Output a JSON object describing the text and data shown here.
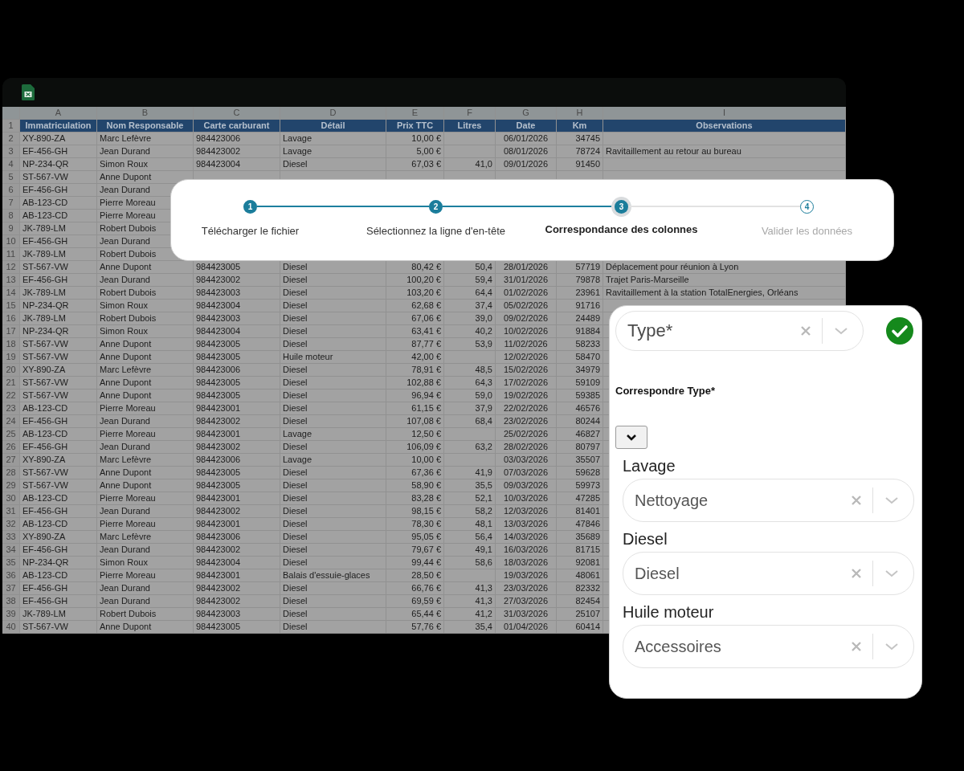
{
  "spreadsheet": {
    "column_letters": [
      "A",
      "B",
      "C",
      "D",
      "E",
      "F",
      "G",
      "H",
      "I"
    ],
    "header": {
      "n": "1",
      "cells": [
        "Immatriculation",
        "Nom Responsable",
        "Carte carburant",
        "Détail",
        "Prix TTC",
        "Litres",
        "Date",
        "Km",
        "Observations"
      ]
    },
    "rows": [
      {
        "n": "2",
        "cells": [
          "XY-890-ZA",
          "Marc Lefèvre",
          "984423006",
          "Lavage",
          "10,00 €",
          null,
          "06/01/2026",
          "34745",
          null
        ]
      },
      {
        "n": "3",
        "cells": [
          "EF-456-GH",
          "Jean Durand",
          "984423002",
          "Lavage",
          "5,00 €",
          null,
          "08/01/2026",
          "78724",
          "Ravitaillement au retour au bureau"
        ]
      },
      {
        "n": "4",
        "cells": [
          "NP-234-QR",
          "Simon Roux",
          "984423004",
          "Diesel",
          "67,03 €",
          "41,0",
          "09/01/2026",
          "91450",
          null
        ]
      },
      {
        "n": "5",
        "cells": [
          "ST-567-VW",
          "Anne Dupont"
        ]
      },
      {
        "n": "6",
        "cells": [
          "EF-456-GH",
          "Jean Durand"
        ]
      },
      {
        "n": "7",
        "cells": [
          "AB-123-CD",
          "Pierre Moreau"
        ]
      },
      {
        "n": "8",
        "cells": [
          "AB-123-CD",
          "Pierre Moreau"
        ]
      },
      {
        "n": "9",
        "cells": [
          "JK-789-LM",
          "Robert Dubois"
        ]
      },
      {
        "n": "10",
        "cells": [
          "EF-456-GH",
          "Jean Durand"
        ]
      },
      {
        "n": "11",
        "cells": [
          "JK-789-LM",
          "Robert Dubois"
        ]
      },
      {
        "n": "12",
        "cells": [
          "ST-567-VW",
          "Anne Dupont",
          "984423005",
          "Diesel",
          "80,42 €",
          "50,4",
          "28/01/2026",
          "57719",
          "Déplacement pour réunion à Lyon"
        ]
      },
      {
        "n": "13",
        "cells": [
          "EF-456-GH",
          "Jean Durand",
          "984423002",
          "Diesel",
          "100,20 €",
          "59,4",
          "31/01/2026",
          "79878",
          "Trajet Paris-Marseille"
        ]
      },
      {
        "n": "14",
        "cells": [
          "JK-789-LM",
          "Robert Dubois",
          "984423003",
          "Diesel",
          "103,20 €",
          "64,4",
          "01/02/2026",
          "23961",
          "Ravitaillement à la station TotalEnergies, Orléans"
        ]
      },
      {
        "n": "15",
        "cells": [
          "NP-234-QR",
          "Simon Roux",
          "984423004",
          "Diesel",
          "62,68 €",
          "37,4",
          "05/02/2026",
          "91716"
        ]
      },
      {
        "n": "16",
        "cells": [
          "JK-789-LM",
          "Robert Dubois",
          "984423003",
          "Diesel",
          "67,06 €",
          "39,0",
          "09/02/2026",
          "24489"
        ]
      },
      {
        "n": "17",
        "cells": [
          "NP-234-QR",
          "Simon Roux",
          "984423004",
          "Diesel",
          "63,41 €",
          "40,2",
          "10/02/2026",
          "91884"
        ]
      },
      {
        "n": "18",
        "cells": [
          "ST-567-VW",
          "Anne Dupont",
          "984423005",
          "Diesel",
          "87,77 €",
          "53,9",
          "11/02/2026",
          "58233"
        ]
      },
      {
        "n": "19",
        "cells": [
          "ST-567-VW",
          "Anne Dupont",
          "984423005",
          "Huile moteur",
          "42,00 €",
          null,
          "12/02/2026",
          "58470"
        ]
      },
      {
        "n": "20",
        "cells": [
          "XY-890-ZA",
          "Marc Lefèvre",
          "984423006",
          "Diesel",
          "78,91 €",
          "48,5",
          "15/02/2026",
          "34979"
        ]
      },
      {
        "n": "21",
        "cells": [
          "ST-567-VW",
          "Anne Dupont",
          "984423005",
          "Diesel",
          "102,88 €",
          "64,3",
          "17/02/2026",
          "59109"
        ]
      },
      {
        "n": "22",
        "cells": [
          "ST-567-VW",
          "Anne Dupont",
          "984423005",
          "Diesel",
          "96,94 €",
          "59,0",
          "19/02/2026",
          "59385"
        ]
      },
      {
        "n": "23",
        "cells": [
          "AB-123-CD",
          "Pierre Moreau",
          "984423001",
          "Diesel",
          "61,15 €",
          "37,9",
          "22/02/2026",
          "46576"
        ]
      },
      {
        "n": "24",
        "cells": [
          "EF-456-GH",
          "Jean Durand",
          "984423002",
          "Diesel",
          "107,08 €",
          "68,4",
          "23/02/2026",
          "80244"
        ]
      },
      {
        "n": "25",
        "cells": [
          "AB-123-CD",
          "Pierre Moreau",
          "984423001",
          "Lavage",
          "12,50 €",
          null,
          "25/02/2026",
          "46827"
        ]
      },
      {
        "n": "26",
        "cells": [
          "EF-456-GH",
          "Jean Durand",
          "984423002",
          "Diesel",
          "106,09 €",
          "63,2",
          "28/02/2026",
          "80797"
        ]
      },
      {
        "n": "27",
        "cells": [
          "XY-890-ZA",
          "Marc Lefèvre",
          "984423006",
          "Lavage",
          "10,00 €",
          null,
          "03/03/2026",
          "35507"
        ]
      },
      {
        "n": "28",
        "cells": [
          "ST-567-VW",
          "Anne Dupont",
          "984423005",
          "Diesel",
          "67,36 €",
          "41,9",
          "07/03/2026",
          "59628"
        ]
      },
      {
        "n": "29",
        "cells": [
          "ST-567-VW",
          "Anne Dupont",
          "984423005",
          "Diesel",
          "58,90 €",
          "35,5",
          "09/03/2026",
          "59973"
        ]
      },
      {
        "n": "30",
        "cells": [
          "AB-123-CD",
          "Pierre Moreau",
          "984423001",
          "Diesel",
          "83,28 €",
          "52,1",
          "10/03/2026",
          "47285"
        ]
      },
      {
        "n": "31",
        "cells": [
          "EF-456-GH",
          "Jean Durand",
          "984423002",
          "Diesel",
          "98,15 €",
          "58,2",
          "12/03/2026",
          "81401"
        ]
      },
      {
        "n": "32",
        "cells": [
          "AB-123-CD",
          "Pierre Moreau",
          "984423001",
          "Diesel",
          "78,30 €",
          "48,1",
          "13/03/2026",
          "47846"
        ]
      },
      {
        "n": "33",
        "cells": [
          "XY-890-ZA",
          "Marc Lefèvre",
          "984423006",
          "Diesel",
          "95,05 €",
          "56,4",
          "14/03/2026",
          "35689"
        ]
      },
      {
        "n": "34",
        "cells": [
          "EF-456-GH",
          "Jean Durand",
          "984423002",
          "Diesel",
          "79,67 €",
          "49,1",
          "16/03/2026",
          "81715"
        ]
      },
      {
        "n": "35",
        "cells": [
          "NP-234-QR",
          "Simon Roux",
          "984423004",
          "Diesel",
          "99,44 €",
          "58,6",
          "18/03/2026",
          "92081"
        ]
      },
      {
        "n": "36",
        "cells": [
          "AB-123-CD",
          "Pierre Moreau",
          "984423001",
          "Balais d'essuie-glaces",
          "28,50 €",
          null,
          "19/03/2026",
          "48061"
        ]
      },
      {
        "n": "37",
        "cells": [
          "EF-456-GH",
          "Jean Durand",
          "984423002",
          "Diesel",
          "66,76 €",
          "41,3",
          "23/03/2026",
          "82332"
        ]
      },
      {
        "n": "38",
        "cells": [
          "EF-456-GH",
          "Jean Durand",
          "984423002",
          "Diesel",
          "69,59 €",
          "41,3",
          "27/03/2026",
          "82454"
        ]
      },
      {
        "n": "39",
        "cells": [
          "JK-789-LM",
          "Robert Dubois",
          "984423003",
          "Diesel",
          "65,44 €",
          "41,2",
          "31/03/2026",
          "25107"
        ]
      },
      {
        "n": "40",
        "cells": [
          "ST-567-VW",
          "Anne Dupont",
          "984423005",
          "Diesel",
          "57,76 €",
          "35,4",
          "01/04/2026",
          "60414"
        ]
      }
    ]
  },
  "stepper": {
    "steps": [
      {
        "number": "1",
        "label": "Télécharger le fichier",
        "kind": "done"
      },
      {
        "number": "2",
        "label": "Sélectionnez la ligne d'en-tête",
        "kind": "done"
      },
      {
        "number": "3",
        "label": "Correspondance des colonnes",
        "kind": "current"
      },
      {
        "number": "4",
        "label": "Valider les données",
        "kind": "upcoming"
      }
    ]
  },
  "mapping_panel": {
    "type_field": {
      "value": "Type*",
      "valid": true
    },
    "match_label": "Correspondre Type*",
    "mappings": [
      {
        "label": "Lavage",
        "value": "Nettoyage"
      },
      {
        "label": "Diesel",
        "value": "Diesel"
      },
      {
        "label": "Huile moteur",
        "value": "Accessoires"
      }
    ]
  }
}
